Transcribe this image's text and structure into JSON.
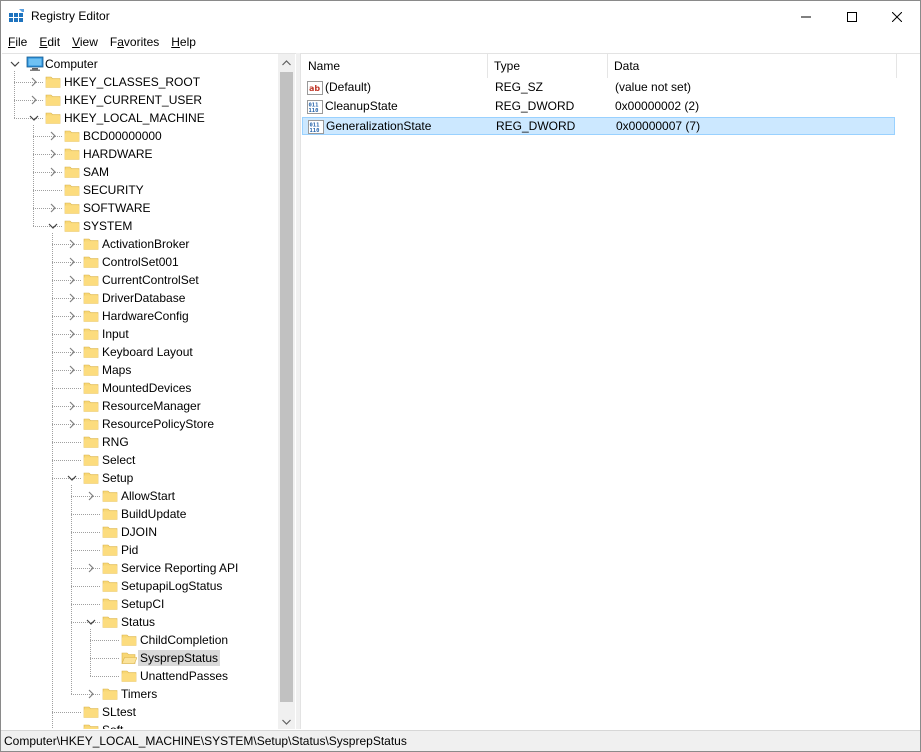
{
  "window": {
    "title": "Registry Editor"
  },
  "menu": [
    {
      "acc": "F",
      "rest": "ile"
    },
    {
      "acc": "E",
      "rest": "dit"
    },
    {
      "acc": "V",
      "rest": "iew"
    },
    {
      "acc": "",
      "pre": "F",
      "acc2": "a",
      "rest": "vorites"
    },
    {
      "acc": "H",
      "rest": "elp"
    }
  ],
  "tree": [
    {
      "label": "Computer",
      "depth": 0,
      "expander": "expanded",
      "icon": "computer-icon"
    },
    {
      "label": "HKEY_CLASSES_ROOT",
      "depth": 1,
      "expander": "collapsed",
      "icon": "folder-icon"
    },
    {
      "label": "HKEY_CURRENT_USER",
      "depth": 1,
      "expander": "collapsed",
      "icon": "folder-icon"
    },
    {
      "label": "HKEY_LOCAL_MACHINE",
      "depth": 1,
      "expander": "expanded",
      "icon": "folder-icon"
    },
    {
      "label": "BCD00000000",
      "depth": 2,
      "expander": "collapsed",
      "icon": "folder-icon"
    },
    {
      "label": "HARDWARE",
      "depth": 2,
      "expander": "collapsed",
      "icon": "folder-icon"
    },
    {
      "label": "SAM",
      "depth": 2,
      "expander": "collapsed",
      "icon": "folder-icon"
    },
    {
      "label": "SECURITY",
      "depth": 2,
      "expander": "none",
      "icon": "folder-icon"
    },
    {
      "label": "SOFTWARE",
      "depth": 2,
      "expander": "collapsed",
      "icon": "folder-icon"
    },
    {
      "label": "SYSTEM",
      "depth": 2,
      "expander": "expanded",
      "icon": "folder-icon"
    },
    {
      "label": "ActivationBroker",
      "depth": 3,
      "expander": "collapsed",
      "icon": "folder-icon"
    },
    {
      "label": "ControlSet001",
      "depth": 3,
      "expander": "collapsed",
      "icon": "folder-icon"
    },
    {
      "label": "CurrentControlSet",
      "depth": 3,
      "expander": "collapsed",
      "icon": "folder-icon"
    },
    {
      "label": "DriverDatabase",
      "depth": 3,
      "expander": "collapsed",
      "icon": "folder-icon"
    },
    {
      "label": "HardwareConfig",
      "depth": 3,
      "expander": "collapsed",
      "icon": "folder-icon"
    },
    {
      "label": "Input",
      "depth": 3,
      "expander": "collapsed",
      "icon": "folder-icon"
    },
    {
      "label": "Keyboard Layout",
      "depth": 3,
      "expander": "collapsed",
      "icon": "folder-icon"
    },
    {
      "label": "Maps",
      "depth": 3,
      "expander": "collapsed",
      "icon": "folder-icon"
    },
    {
      "label": "MountedDevices",
      "depth": 3,
      "expander": "none",
      "icon": "folder-icon"
    },
    {
      "label": "ResourceManager",
      "depth": 3,
      "expander": "collapsed",
      "icon": "folder-icon"
    },
    {
      "label": "ResourcePolicyStore",
      "depth": 3,
      "expander": "collapsed",
      "icon": "folder-icon"
    },
    {
      "label": "RNG",
      "depth": 3,
      "expander": "none",
      "icon": "folder-icon"
    },
    {
      "label": "Select",
      "depth": 3,
      "expander": "none",
      "icon": "folder-icon"
    },
    {
      "label": "Setup",
      "depth": 3,
      "expander": "expanded",
      "icon": "folder-icon"
    },
    {
      "label": "AllowStart",
      "depth": 4,
      "expander": "collapsed",
      "icon": "folder-icon"
    },
    {
      "label": "BuildUpdate",
      "depth": 4,
      "expander": "none",
      "icon": "folder-icon"
    },
    {
      "label": "DJOIN",
      "depth": 4,
      "expander": "none",
      "icon": "folder-icon"
    },
    {
      "label": "Pid",
      "depth": 4,
      "expander": "none",
      "icon": "folder-icon"
    },
    {
      "label": "Service Reporting API",
      "depth": 4,
      "expander": "collapsed",
      "icon": "folder-icon"
    },
    {
      "label": "SetupapiLogStatus",
      "depth": 4,
      "expander": "none",
      "icon": "folder-icon"
    },
    {
      "label": "SetupCI",
      "depth": 4,
      "expander": "none",
      "icon": "folder-icon"
    },
    {
      "label": "Status",
      "depth": 4,
      "expander": "expanded",
      "icon": "folder-icon"
    },
    {
      "label": "ChildCompletion",
      "depth": 5,
      "expander": "none",
      "icon": "folder-icon"
    },
    {
      "label": "SysprepStatus",
      "depth": 5,
      "expander": "none",
      "icon": "folder-open-icon",
      "selected": true
    },
    {
      "label": "UnattendPasses",
      "depth": 5,
      "expander": "none",
      "icon": "folder-icon"
    },
    {
      "label": "Timers",
      "depth": 4,
      "expander": "collapsed",
      "icon": "folder-icon"
    },
    {
      "label": "SLtest",
      "depth": 3,
      "expander": "none",
      "icon": "folder-icon"
    },
    {
      "label": "Soft...",
      "depth": 3,
      "expander": "none",
      "icon": "folder-icon"
    }
  ],
  "list": {
    "columns": [
      "Name",
      "Type",
      "Data"
    ],
    "rows": [
      {
        "name": "(Default)",
        "type": "REG_SZ",
        "data": "(value not set)",
        "icon": "string-value-icon",
        "selected": false
      },
      {
        "name": "CleanupState",
        "type": "REG_DWORD",
        "data": "0x00000002 (2)",
        "icon": "binary-value-icon",
        "selected": false
      },
      {
        "name": "GeneralizationState",
        "type": "REG_DWORD",
        "data": "0x00000007 (7)",
        "icon": "binary-value-icon",
        "selected": true
      }
    ]
  },
  "status": {
    "path": "Computer\\HKEY_LOCAL_MACHINE\\SYSTEM\\Setup\\Status\\SysprepStatus"
  },
  "colors": {
    "selection": "#cce8ff",
    "selection_border": "#99d1ff",
    "tree_selected": "#d9d9d9",
    "folder": "#f8d775"
  }
}
